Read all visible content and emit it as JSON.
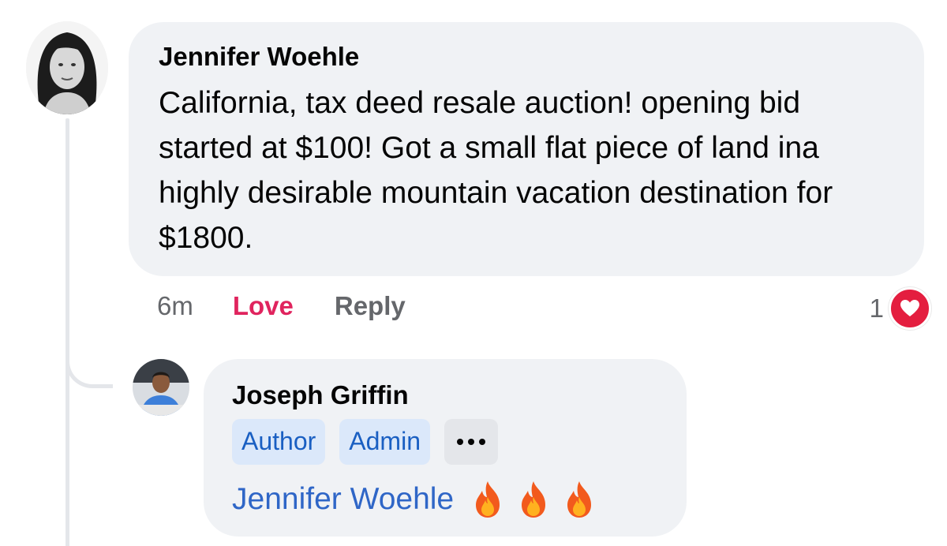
{
  "comment": {
    "author": "Jennifer Woehle",
    "text": "California, tax deed resale auction! opening bid started at $100! Got a small flat piece of land ina highly desirable mountain vacation destination for $1800.",
    "time": "6m",
    "love_label": "Love",
    "reply_label": "Reply",
    "reaction_count": "1",
    "reaction_icon": "heart-icon"
  },
  "reply": {
    "author": "Joseph Griffin",
    "badges": [
      "Author",
      "Admin"
    ],
    "more_icon": "more-icon",
    "mention": "Jennifer Woehle",
    "emojis": [
      "fire-icon",
      "fire-icon",
      "fire-icon"
    ]
  },
  "colors": {
    "bubble": "#f0f2f5",
    "love": "#e0245e",
    "heart": "#e41e3f",
    "badge_bg": "#dbe8fa",
    "badge_text": "#1a5fc2",
    "mention": "#2f66c7"
  }
}
